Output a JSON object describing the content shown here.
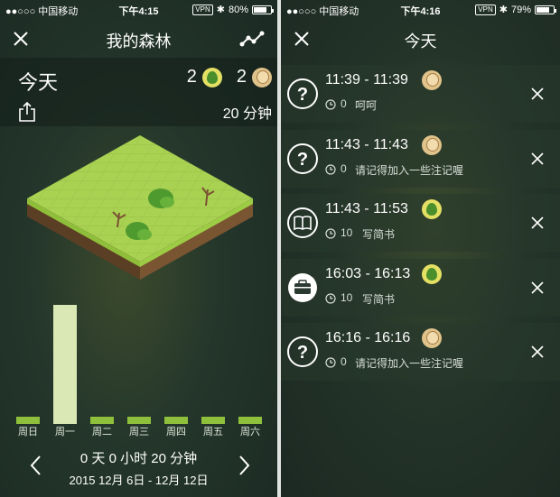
{
  "left": {
    "status": {
      "carrier": "●●○○○ 中国移动",
      "time": "下午4:15",
      "vpn": "VPN",
      "battery": "80%",
      "battery_level": 0.8
    },
    "title": "我的森林",
    "today_label": "今天",
    "alive_count": "2",
    "dead_count": "2",
    "minutes": "20 分钟",
    "week": {
      "days": [
        "周日",
        "周一",
        "周二",
        "周三",
        "周四",
        "周五",
        "周六"
      ],
      "active_index": 1,
      "values": [
        0,
        20,
        0,
        0,
        0,
        0,
        0
      ]
    },
    "summary": "0 天 0 小时 20 分钟",
    "range": "2015 12月 6日 - 12月 12日",
    "icons": [
      "close-icon",
      "chart-line-icon",
      "share-icon",
      "chevron-left-icon",
      "chevron-right-icon"
    ]
  },
  "right": {
    "status": {
      "carrier": "●●○○○ 中国移动",
      "time": "下午4:16",
      "vpn": "VPN",
      "battery": "79%",
      "battery_level": 0.79
    },
    "title": "今天",
    "sessions": [
      {
        "type": "question",
        "time": "11:39 - 11:39",
        "tree": "dead",
        "duration": "0",
        "note": "呵呵"
      },
      {
        "type": "question",
        "time": "11:43 - 11:43",
        "tree": "dead",
        "duration": "0",
        "note": "请记得加入一些注记喔"
      },
      {
        "type": "book",
        "time": "11:43 - 11:53",
        "tree": "alive",
        "duration": "10",
        "note": "写简书"
      },
      {
        "type": "briefcase",
        "time": "16:03 - 16:13",
        "tree": "alive",
        "duration": "10",
        "note": "写简书"
      },
      {
        "type": "question",
        "time": "16:16 - 16:16",
        "tree": "dead",
        "duration": "0",
        "note": "请记得加入一些注记喔"
      }
    ]
  },
  "colors": {
    "bar": "#8fc03c",
    "bar_active": "#d9e8b4",
    "alive": "#4a8f2b",
    "dead": "#e0c38a"
  }
}
